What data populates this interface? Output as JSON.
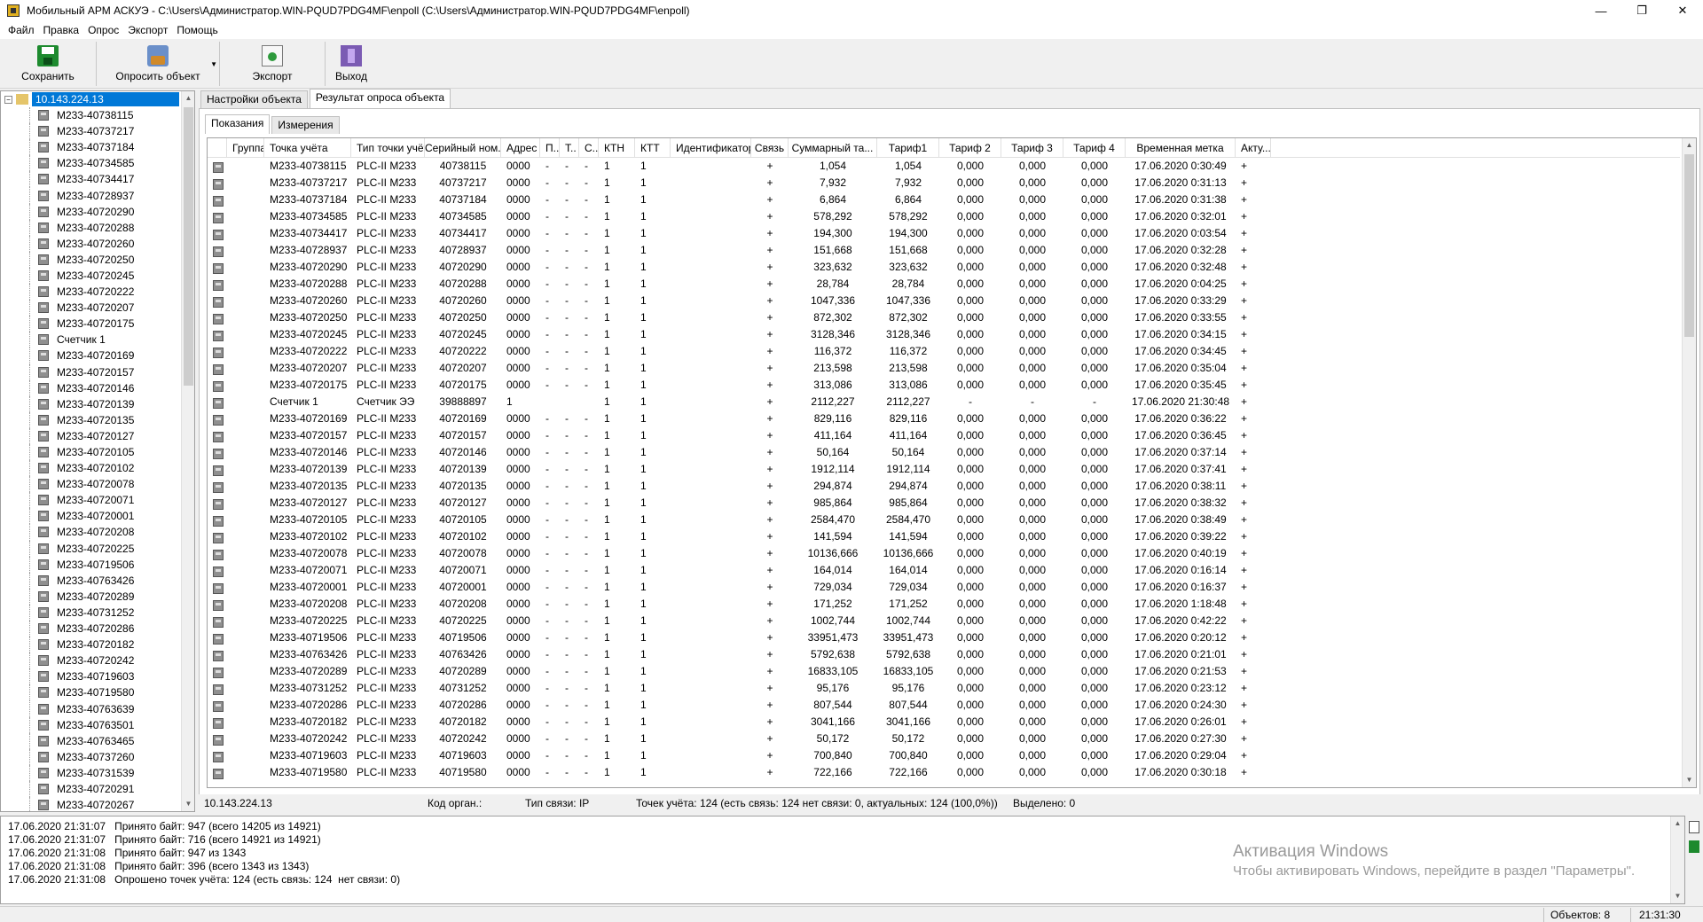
{
  "window": {
    "title": "Мобильный АРМ АСКУЭ - C:\\Users\\Администратор.WIN-PQUD7PDG4MF\\enpoll (C:\\Users\\Администратор.WIN-PQUD7PDG4MF\\enpoll)",
    "minimize": "—",
    "maximize": "❐",
    "close": "✕"
  },
  "menu": [
    "Файл",
    "Правка",
    "Опрос",
    "Экспорт",
    "Помощь"
  ],
  "toolbar": {
    "save": "Сохранить",
    "poll": "Опросить объект",
    "export": "Экспорт",
    "exit": "Выход"
  },
  "tree": {
    "root": "10.143.224.13",
    "items": [
      "M233-40738115",
      "M233-40737217",
      "M233-40737184",
      "M233-40734585",
      "M233-40734417",
      "M233-40728937",
      "M233-40720290",
      "M233-40720288",
      "M233-40720260",
      "M233-40720250",
      "M233-40720245",
      "M233-40720222",
      "M233-40720207",
      "M233-40720175",
      "Счетчик 1",
      "M233-40720169",
      "M233-40720157",
      "M233-40720146",
      "M233-40720139",
      "M233-40720135",
      "M233-40720127",
      "M233-40720105",
      "M233-40720102",
      "M233-40720078",
      "M233-40720071",
      "M233-40720001",
      "M233-40720208",
      "M233-40720225",
      "M233-40719506",
      "M233-40763426",
      "M233-40720289",
      "M233-40731252",
      "M233-40720286",
      "M233-40720182",
      "M233-40720242",
      "M233-40719603",
      "M233-40719580",
      "M233-40763639",
      "M233-40763501",
      "M233-40763465",
      "M233-40737260",
      "M233-40731539",
      "M233-40720291",
      "M233-40720267"
    ]
  },
  "tabs": {
    "outer": [
      "Настройки объекта",
      "Результат опроса объекта"
    ],
    "inner": [
      "Показания",
      "Измерения"
    ]
  },
  "grid": {
    "columns": [
      "",
      "Группа",
      "Точка учёта",
      "Тип точки учёта",
      "Серийный ном...",
      "Адрес",
      "П..",
      "Т..",
      "С..",
      "КТН",
      "КТТ",
      "Идентификатор",
      "Связь",
      "Суммарный та...",
      "Тариф1",
      "Тариф 2",
      "Тариф 3",
      "Тариф 4",
      "Временная метка",
      "Акту..."
    ],
    "rows": [
      [
        "M233-40738115",
        "PLC-II M233",
        "40738115",
        "0000",
        "-",
        "-",
        "-",
        "1",
        "1",
        "",
        "+",
        "1,054",
        "1,054",
        "0,000",
        "0,000",
        "0,000",
        "17.06.2020 0:30:49",
        "+"
      ],
      [
        "M233-40737217",
        "PLC-II M233",
        "40737217",
        "0000",
        "-",
        "-",
        "-",
        "1",
        "1",
        "",
        "+",
        "7,932",
        "7,932",
        "0,000",
        "0,000",
        "0,000",
        "17.06.2020 0:31:13",
        "+"
      ],
      [
        "M233-40737184",
        "PLC-II M233",
        "40737184",
        "0000",
        "-",
        "-",
        "-",
        "1",
        "1",
        "",
        "+",
        "6,864",
        "6,864",
        "0,000",
        "0,000",
        "0,000",
        "17.06.2020 0:31:38",
        "+"
      ],
      [
        "M233-40734585",
        "PLC-II M233",
        "40734585",
        "0000",
        "-",
        "-",
        "-",
        "1",
        "1",
        "",
        "+",
        "578,292",
        "578,292",
        "0,000",
        "0,000",
        "0,000",
        "17.06.2020 0:32:01",
        "+"
      ],
      [
        "M233-40734417",
        "PLC-II M233",
        "40734417",
        "0000",
        "-",
        "-",
        "-",
        "1",
        "1",
        "",
        "+",
        "194,300",
        "194,300",
        "0,000",
        "0,000",
        "0,000",
        "17.06.2020 0:03:54",
        "+"
      ],
      [
        "M233-40728937",
        "PLC-II M233",
        "40728937",
        "0000",
        "-",
        "-",
        "-",
        "1",
        "1",
        "",
        "+",
        "151,668",
        "151,668",
        "0,000",
        "0,000",
        "0,000",
        "17.06.2020 0:32:28",
        "+"
      ],
      [
        "M233-40720290",
        "PLC-II M233",
        "40720290",
        "0000",
        "-",
        "-",
        "-",
        "1",
        "1",
        "",
        "+",
        "323,632",
        "323,632",
        "0,000",
        "0,000",
        "0,000",
        "17.06.2020 0:32:48",
        "+"
      ],
      [
        "M233-40720288",
        "PLC-II M233",
        "40720288",
        "0000",
        "-",
        "-",
        "-",
        "1",
        "1",
        "",
        "+",
        "28,784",
        "28,784",
        "0,000",
        "0,000",
        "0,000",
        "17.06.2020 0:04:25",
        "+"
      ],
      [
        "M233-40720260",
        "PLC-II M233",
        "40720260",
        "0000",
        "-",
        "-",
        "-",
        "1",
        "1",
        "",
        "+",
        "1047,336",
        "1047,336",
        "0,000",
        "0,000",
        "0,000",
        "17.06.2020 0:33:29",
        "+"
      ],
      [
        "M233-40720250",
        "PLC-II M233",
        "40720250",
        "0000",
        "-",
        "-",
        "-",
        "1",
        "1",
        "",
        "+",
        "872,302",
        "872,302",
        "0,000",
        "0,000",
        "0,000",
        "17.06.2020 0:33:55",
        "+"
      ],
      [
        "M233-40720245",
        "PLC-II M233",
        "40720245",
        "0000",
        "-",
        "-",
        "-",
        "1",
        "1",
        "",
        "+",
        "3128,346",
        "3128,346",
        "0,000",
        "0,000",
        "0,000",
        "17.06.2020 0:34:15",
        "+"
      ],
      [
        "M233-40720222",
        "PLC-II M233",
        "40720222",
        "0000",
        "-",
        "-",
        "-",
        "1",
        "1",
        "",
        "+",
        "116,372",
        "116,372",
        "0,000",
        "0,000",
        "0,000",
        "17.06.2020 0:34:45",
        "+"
      ],
      [
        "M233-40720207",
        "PLC-II M233",
        "40720207",
        "0000",
        "-",
        "-",
        "-",
        "1",
        "1",
        "",
        "+",
        "213,598",
        "213,598",
        "0,000",
        "0,000",
        "0,000",
        "17.06.2020 0:35:04",
        "+"
      ],
      [
        "M233-40720175",
        "PLC-II M233",
        "40720175",
        "0000",
        "-",
        "-",
        "-",
        "1",
        "1",
        "",
        "+",
        "313,086",
        "313,086",
        "0,000",
        "0,000",
        "0,000",
        "17.06.2020 0:35:45",
        "+"
      ],
      [
        "Счетчик 1",
        "Счетчик ЭЭ",
        "39888897",
        "1",
        "",
        "",
        "",
        "1",
        "1",
        "",
        "+",
        "2112,227",
        "2112,227",
        "-",
        "-",
        "-",
        "17.06.2020 21:30:48",
        "+"
      ],
      [
        "M233-40720169",
        "PLC-II M233",
        "40720169",
        "0000",
        "-",
        "-",
        "-",
        "1",
        "1",
        "",
        "+",
        "829,116",
        "829,116",
        "0,000",
        "0,000",
        "0,000",
        "17.06.2020 0:36:22",
        "+"
      ],
      [
        "M233-40720157",
        "PLC-II M233",
        "40720157",
        "0000",
        "-",
        "-",
        "-",
        "1",
        "1",
        "",
        "+",
        "411,164",
        "411,164",
        "0,000",
        "0,000",
        "0,000",
        "17.06.2020 0:36:45",
        "+"
      ],
      [
        "M233-40720146",
        "PLC-II M233",
        "40720146",
        "0000",
        "-",
        "-",
        "-",
        "1",
        "1",
        "",
        "+",
        "50,164",
        "50,164",
        "0,000",
        "0,000",
        "0,000",
        "17.06.2020 0:37:14",
        "+"
      ],
      [
        "M233-40720139",
        "PLC-II M233",
        "40720139",
        "0000",
        "-",
        "-",
        "-",
        "1",
        "1",
        "",
        "+",
        "1912,114",
        "1912,114",
        "0,000",
        "0,000",
        "0,000",
        "17.06.2020 0:37:41",
        "+"
      ],
      [
        "M233-40720135",
        "PLC-II M233",
        "40720135",
        "0000",
        "-",
        "-",
        "-",
        "1",
        "1",
        "",
        "+",
        "294,874",
        "294,874",
        "0,000",
        "0,000",
        "0,000",
        "17.06.2020 0:38:11",
        "+"
      ],
      [
        "M233-40720127",
        "PLC-II M233",
        "40720127",
        "0000",
        "-",
        "-",
        "-",
        "1",
        "1",
        "",
        "+",
        "985,864",
        "985,864",
        "0,000",
        "0,000",
        "0,000",
        "17.06.2020 0:38:32",
        "+"
      ],
      [
        "M233-40720105",
        "PLC-II M233",
        "40720105",
        "0000",
        "-",
        "-",
        "-",
        "1",
        "1",
        "",
        "+",
        "2584,470",
        "2584,470",
        "0,000",
        "0,000",
        "0,000",
        "17.06.2020 0:38:49",
        "+"
      ],
      [
        "M233-40720102",
        "PLC-II M233",
        "40720102",
        "0000",
        "-",
        "-",
        "-",
        "1",
        "1",
        "",
        "+",
        "141,594",
        "141,594",
        "0,000",
        "0,000",
        "0,000",
        "17.06.2020 0:39:22",
        "+"
      ],
      [
        "M233-40720078",
        "PLC-II M233",
        "40720078",
        "0000",
        "-",
        "-",
        "-",
        "1",
        "1",
        "",
        "+",
        "10136,666",
        "10136,666",
        "0,000",
        "0,000",
        "0,000",
        "17.06.2020 0:40:19",
        "+"
      ],
      [
        "M233-40720071",
        "PLC-II M233",
        "40720071",
        "0000",
        "-",
        "-",
        "-",
        "1",
        "1",
        "",
        "+",
        "164,014",
        "164,014",
        "0,000",
        "0,000",
        "0,000",
        "17.06.2020 0:16:14",
        "+"
      ],
      [
        "M233-40720001",
        "PLC-II M233",
        "40720001",
        "0000",
        "-",
        "-",
        "-",
        "1",
        "1",
        "",
        "+",
        "729,034",
        "729,034",
        "0,000",
        "0,000",
        "0,000",
        "17.06.2020 0:16:37",
        "+"
      ],
      [
        "M233-40720208",
        "PLC-II M233",
        "40720208",
        "0000",
        "-",
        "-",
        "-",
        "1",
        "1",
        "",
        "+",
        "171,252",
        "171,252",
        "0,000",
        "0,000",
        "0,000",
        "17.06.2020 1:18:48",
        "+"
      ],
      [
        "M233-40720225",
        "PLC-II M233",
        "40720225",
        "0000",
        "-",
        "-",
        "-",
        "1",
        "1",
        "",
        "+",
        "1002,744",
        "1002,744",
        "0,000",
        "0,000",
        "0,000",
        "17.06.2020 0:42:22",
        "+"
      ],
      [
        "M233-40719506",
        "PLC-II M233",
        "40719506",
        "0000",
        "-",
        "-",
        "-",
        "1",
        "1",
        "",
        "+",
        "33951,473",
        "33951,473",
        "0,000",
        "0,000",
        "0,000",
        "17.06.2020 0:20:12",
        "+"
      ],
      [
        "M233-40763426",
        "PLC-II M233",
        "40763426",
        "0000",
        "-",
        "-",
        "-",
        "1",
        "1",
        "",
        "+",
        "5792,638",
        "5792,638",
        "0,000",
        "0,000",
        "0,000",
        "17.06.2020 0:21:01",
        "+"
      ],
      [
        "M233-40720289",
        "PLC-II M233",
        "40720289",
        "0000",
        "-",
        "-",
        "-",
        "1",
        "1",
        "",
        "+",
        "16833,105",
        "16833,105",
        "0,000",
        "0,000",
        "0,000",
        "17.06.2020 0:21:53",
        "+"
      ],
      [
        "M233-40731252",
        "PLC-II M233",
        "40731252",
        "0000",
        "-",
        "-",
        "-",
        "1",
        "1",
        "",
        "+",
        "95,176",
        "95,176",
        "0,000",
        "0,000",
        "0,000",
        "17.06.2020 0:23:12",
        "+"
      ],
      [
        "M233-40720286",
        "PLC-II M233",
        "40720286",
        "0000",
        "-",
        "-",
        "-",
        "1",
        "1",
        "",
        "+",
        "807,544",
        "807,544",
        "0,000",
        "0,000",
        "0,000",
        "17.06.2020 0:24:30",
        "+"
      ],
      [
        "M233-40720182",
        "PLC-II M233",
        "40720182",
        "0000",
        "-",
        "-",
        "-",
        "1",
        "1",
        "",
        "+",
        "3041,166",
        "3041,166",
        "0,000",
        "0,000",
        "0,000",
        "17.06.2020 0:26:01",
        "+"
      ],
      [
        "M233-40720242",
        "PLC-II M233",
        "40720242",
        "0000",
        "-",
        "-",
        "-",
        "1",
        "1",
        "",
        "+",
        "50,172",
        "50,172",
        "0,000",
        "0,000",
        "0,000",
        "17.06.2020 0:27:30",
        "+"
      ],
      [
        "M233-40719603",
        "PLC-II M233",
        "40719603",
        "0000",
        "-",
        "-",
        "-",
        "1",
        "1",
        "",
        "+",
        "700,840",
        "700,840",
        "0,000",
        "0,000",
        "0,000",
        "17.06.2020 0:29:04",
        "+"
      ],
      [
        "M233-40719580",
        "PLC-II M233",
        "40719580",
        "0000",
        "-",
        "-",
        "-",
        "1",
        "1",
        "",
        "+",
        "722,166",
        "722,166",
        "0,000",
        "0,000",
        "0,000",
        "17.06.2020 0:30:18",
        "+"
      ]
    ]
  },
  "grid_status": {
    "object": "10.143.224.13",
    "org_code": "Код орган.:",
    "link_type": "Тип связи: IP",
    "points": "Точек учёта: 124 (есть связь: 124  нет связи: 0, актуальных: 124 (100,0%))",
    "selected": "Выделено: 0"
  },
  "log": [
    "17.06.2020 21:31:07   Принято байт: 947 (всего 14205 из 14921)",
    "17.06.2020 21:31:07   Принято байт: 716 (всего 14921 из 14921)",
    "17.06.2020 21:31:08   Принято байт: 947 из 1343",
    "17.06.2020 21:31:08   Принято байт: 396 (всего 1343 из 1343)",
    "17.06.2020 21:31:08   Опрошено точек учёта: 124 (есть связь: 124  нет связи: 0)"
  ],
  "watermark": {
    "line1": "Активация Windows",
    "line2": "Чтобы активировать Windows, перейдите в раздел \"Параметры\"."
  },
  "statusbar": {
    "objects": "Объектов: 8",
    "time": "21:31:30"
  }
}
